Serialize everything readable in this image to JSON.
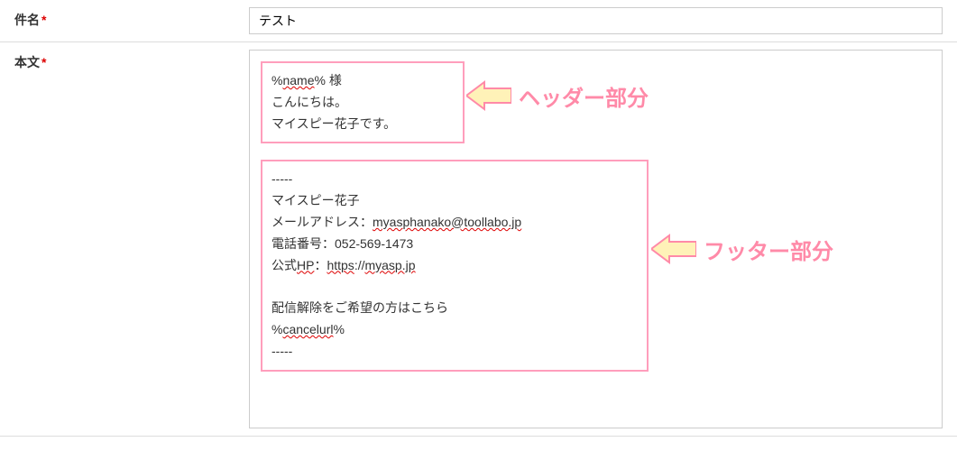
{
  "subject": {
    "label": "件名",
    "value": "テスト"
  },
  "body": {
    "label": "本文"
  },
  "header_block": {
    "line1_pre": "%",
    "line1_name": "name",
    "line1_post": "% 様",
    "line2": "こんにちは。",
    "line3": "マイスピー花子です。"
  },
  "footer_block": {
    "divider": "-----",
    "name_line": "マイスピー花子",
    "email_label": "メールアドレス：",
    "email_value": "myasphanako@toollabo.jp",
    "phone_label": "電話番号：",
    "phone_value": "052-569-1473",
    "site_label_pre": "公式",
    "site_label_hp": "HP",
    "site_label_post": "：",
    "site_value_https": "https",
    "site_value_post": "://",
    "site_value_domain": "myasp.jp",
    "unsubscribe_text": "配信解除をご希望の方はこちら",
    "cancelurl_pre": "%",
    "cancelurl_name": "cancelurl",
    "cancelurl_post": "%"
  },
  "callouts": {
    "header": "ヘッダー部分",
    "footer": "フッター部分"
  }
}
